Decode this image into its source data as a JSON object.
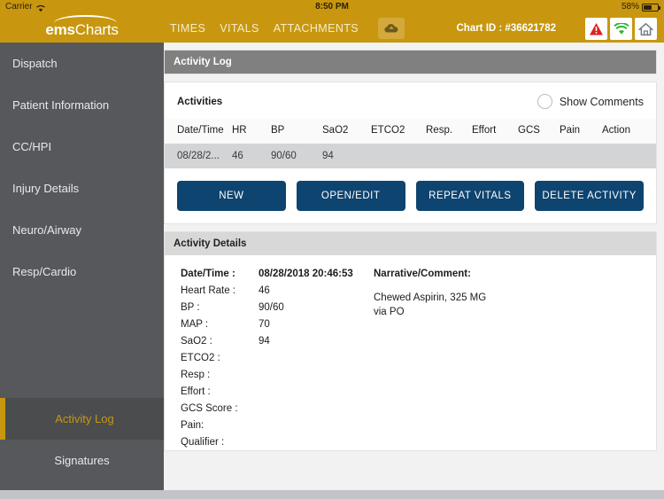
{
  "status_bar": {
    "carrier": "Carrier",
    "wifi_icon": "wifi-icon",
    "time": "8:50 PM",
    "battery_percent": "58%",
    "battery_icon": "battery-icon"
  },
  "topbar": {
    "logo_bold": "ems",
    "logo_light": "Charts",
    "nav_items": [
      {
        "label": "TIMES",
        "name": "nav-times"
      },
      {
        "label": "VITALS",
        "name": "nav-vitals"
      },
      {
        "label": "ATTACHMENTS",
        "name": "nav-attachments"
      }
    ],
    "upload_icon": "cloud-upload-icon",
    "chart_id": "Chart ID : #36621782",
    "icon_buttons": [
      {
        "name": "warning-icon",
        "color": "#e02020"
      },
      {
        "name": "wifi-status-icon",
        "color": "#2eb82e"
      },
      {
        "name": "home-icon",
        "color": "#6e7b8b"
      }
    ]
  },
  "sidebar": {
    "items": [
      {
        "label": "Dispatch"
      },
      {
        "label": "Patient Information"
      },
      {
        "label": "CC/HPI"
      },
      {
        "label": "Injury Details"
      },
      {
        "label": "Neuro/Airway"
      },
      {
        "label": "Resp/Cardio"
      }
    ],
    "bottom_items": [
      {
        "label": "Activity Log",
        "active": true
      },
      {
        "label": "Signatures",
        "active": false
      }
    ],
    "accent_color": "#c8970f"
  },
  "activity_log": {
    "panel_title": "Activity Log",
    "section_title": "Activities",
    "show_comments_label": "Show Comments",
    "show_comments_checked": false,
    "columns": [
      "Date/Time",
      "HR",
      "BP",
      "SaO2",
      "ETCO2",
      "Resp.",
      "Effort",
      "GCS",
      "Pain",
      "Action"
    ],
    "rows": [
      {
        "datetime": "08/28/2...",
        "hr": "46",
        "bp": "90/60",
        "sao2": "94",
        "etco2": "",
        "resp": "",
        "effort": "",
        "gcs": "",
        "pain": "",
        "action": ""
      }
    ],
    "buttons": [
      {
        "label": "NEW",
        "name": "new-button"
      },
      {
        "label": "OPEN/EDIT",
        "name": "open-edit-button"
      },
      {
        "label": "REPEAT VITALS",
        "name": "repeat-vitals-button"
      },
      {
        "label": "DELETE ACTIVITY",
        "name": "delete-activity-button"
      }
    ],
    "button_color": "#0e4470"
  },
  "activity_details": {
    "panel_title": "Activity Details",
    "fields": [
      {
        "label": "Date/Time :",
        "value": "08/28/2018 20:46:53",
        "bold": true
      },
      {
        "label": "Heart Rate :",
        "value": "46",
        "bold": false
      },
      {
        "label": "BP :",
        "value": "90/60",
        "bold": false
      },
      {
        "label": "MAP :",
        "value": "70",
        "bold": false
      },
      {
        "label": "SaO2 :",
        "value": "94",
        "bold": false
      },
      {
        "label": "ETCO2 :",
        "value": "",
        "bold": false
      },
      {
        "label": "Resp :",
        "value": "",
        "bold": false
      },
      {
        "label": "Effort :",
        "value": "",
        "bold": false
      },
      {
        "label": "GCS Score :",
        "value": "",
        "bold": false
      },
      {
        "label": "Pain:",
        "value": "",
        "bold": false
      },
      {
        "label": "Qualifier :",
        "value": "",
        "bold": false
      }
    ],
    "narrative_header": "Narrative/Comment:",
    "narrative_line1": "Chewed Aspirin, 325 MG",
    "narrative_line2": "via PO"
  }
}
